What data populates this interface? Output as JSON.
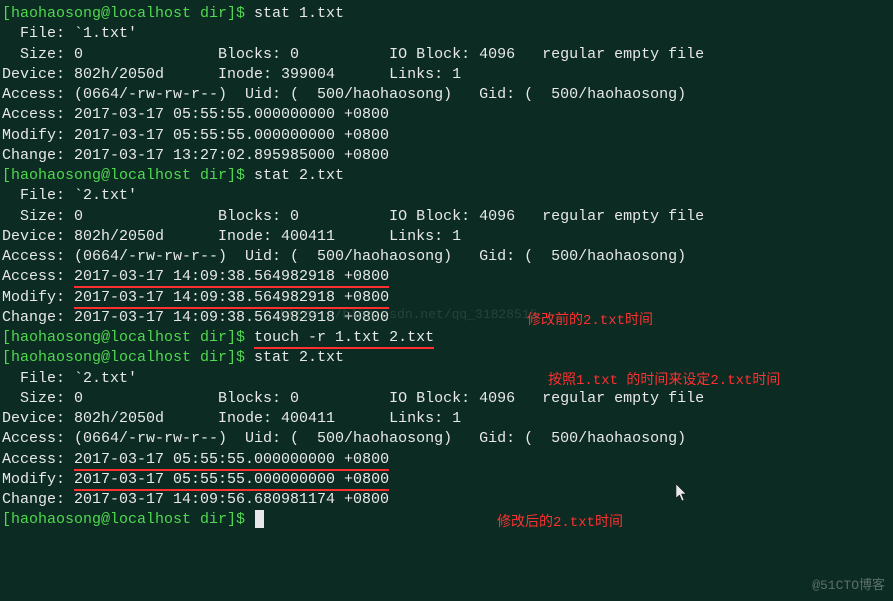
{
  "prompt": "[haohaosong@localhost dir]$ ",
  "cmd1": "stat 1.txt",
  "cmd2": "stat 2.txt",
  "cmd3": "touch -r 1.txt 2.txt",
  "cmd4": "stat 2.txt",
  "block1": {
    "file": "  File: `1.txt'",
    "size": "  Size: 0               Blocks: 0          IO Block: 4096   regular empty file",
    "device": "Device: 802h/2050d      Inode: 399004      Links: 1",
    "access_perm": "Access: (0664/-rw-rw-r--)  Uid: (  500/haohaosong)   Gid: (  500/haohaosong)",
    "access_time": "Access: 2017-03-17 05:55:55.000000000 +0800",
    "modify_time": "Modify: 2017-03-17 05:55:55.000000000 +0800",
    "change_time": "Change: 2017-03-17 13:27:02.895985000 +0800"
  },
  "block2": {
    "file": "  File: `2.txt'",
    "size": "  Size: 0               Blocks: 0          IO Block: 4096   regular empty file",
    "device": "Device: 802h/2050d      Inode: 400411      Links: 1",
    "access_perm": "Access: (0664/-rw-rw-r--)  Uid: (  500/haohaosong)   Gid: (  500/haohaosong)",
    "access_prefix": "Access: ",
    "access_time_val": "2017-03-17 14:09:38.564982918 +0800",
    "modify_prefix": "Modify: ",
    "modify_time_val": "2017-03-17 14:09:38.564982918 +0800",
    "change_time": "Change: 2017-03-17 14:09:38.564982918 +0800"
  },
  "block3": {
    "file": "  File: `2.txt'",
    "size": "  Size: 0               Blocks: 0          IO Block: 4096   regular empty file",
    "device": "Device: 802h/2050d      Inode: 400411      Links: 1",
    "access_perm": "Access: (0664/-rw-rw-r--)  Uid: (  500/haohaosong)   Gid: (  500/haohaosong)",
    "access_prefix": "Access: ",
    "access_time_val": "2017-03-17 05:55:55.000000000 +0800",
    "modify_prefix": "Modify: ",
    "modify_time_val": "2017-03-17 05:55:55.000000000 +0800",
    "change_time": "Change: 2017-03-17 14:09:56.680981174 +0800"
  },
  "annotations": {
    "before": "修改前的2.txt时间",
    "touch_note": "按照1.txt 的时间来设定2.txt时间",
    "after": "修改后的2.txt时间"
  },
  "watermark_center": "https://blog.csdn.net/qq_31828515",
  "watermark_br": "@51CTO博客"
}
